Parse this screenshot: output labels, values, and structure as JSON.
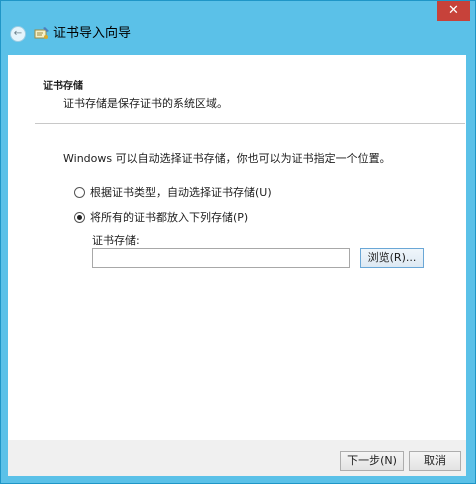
{
  "titlebar": {
    "close_label": "✕",
    "back_symbol": "←",
    "title": "证书导入向导"
  },
  "section": {
    "heading": "证书存储",
    "description": "证书存储是保存证书的系统区域。"
  },
  "intro": "Windows 可以自动选择证书存储，你也可以为证书指定一个位置。",
  "options": {
    "auto_label": "根据证书类型，自动选择证书存储(U)",
    "manual_label": "将所有的证书都放入下列存储(P)"
  },
  "store": {
    "label": "证书存储:",
    "value": "",
    "browse_label": "浏览(R)..."
  },
  "footer": {
    "next_label": "下一步(N)",
    "cancel_label": "取消"
  },
  "colors": {
    "titlebar": "#5bc1e8",
    "close": "#c7423a",
    "accent_border": "#6aa7d6"
  }
}
